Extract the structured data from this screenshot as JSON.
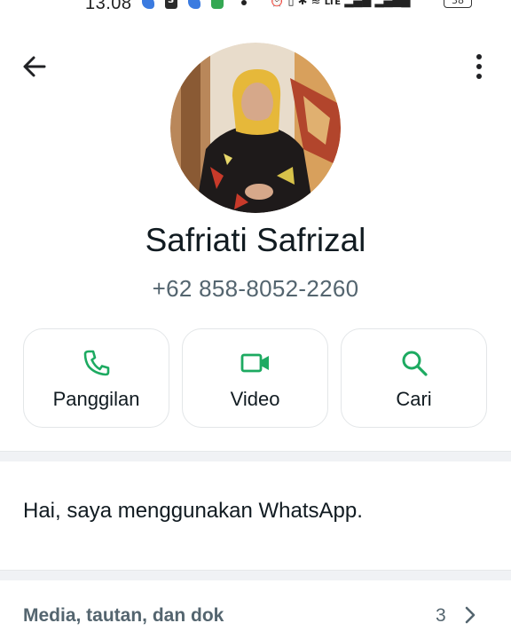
{
  "status_bar": {
    "time": "13.08",
    "network": "LTE",
    "battery": "38"
  },
  "contact": {
    "name": "Safriati Safrizal",
    "phone": "+62 858-8052-2260",
    "about": "Hai, saya menggunakan WhatsApp."
  },
  "actions": [
    {
      "label": "Panggilan",
      "icon": "phone-icon"
    },
    {
      "label": "Video",
      "icon": "video-icon"
    },
    {
      "label": "Cari",
      "icon": "search-icon"
    }
  ],
  "media": {
    "label": "Media, tautan, dan dok",
    "count": "3"
  },
  "colors": {
    "accent_green": "#1daa61",
    "text_primary": "#111b21",
    "text_secondary": "#54656f",
    "divider": "#f0f2f5"
  }
}
